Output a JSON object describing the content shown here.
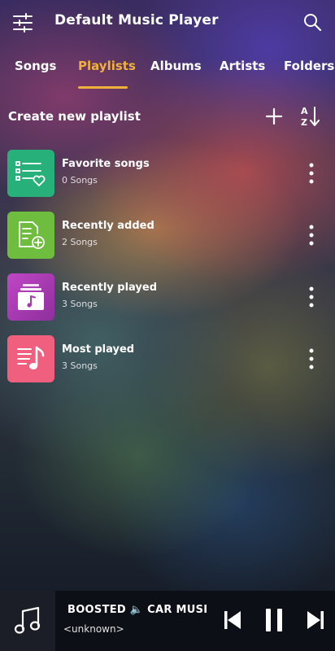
{
  "header": {
    "title": "Default Music Player",
    "menu_icon": "equalizer-sliders-icon",
    "search_icon": "search-icon"
  },
  "tabs": [
    {
      "label": "Songs",
      "active": false
    },
    {
      "label": "Playlists",
      "active": true
    },
    {
      "label": "Albums",
      "active": false
    },
    {
      "label": "Artists",
      "active": false
    },
    {
      "label": "Folders",
      "active": false
    }
  ],
  "create_row": {
    "label": "Create new playlist",
    "add_icon": "plus-icon",
    "sort_icon": "sort-a-z-icon"
  },
  "playlists": [
    {
      "title": "Favorite songs",
      "subtitle": "0 Songs",
      "icon": "favorite-list-icon",
      "color": "#27b07a"
    },
    {
      "title": "Recently added",
      "subtitle": "2 Songs",
      "icon": "add-document-icon",
      "color": "#6ebd3f"
    },
    {
      "title": "Recently played",
      "subtitle": "3 Songs",
      "icon": "music-box-icon",
      "color": "#b13fb8"
    },
    {
      "title": "Most played",
      "subtitle": "3 Songs",
      "icon": "music-list-icon",
      "color": "#f0607e"
    }
  ],
  "player": {
    "track_before": "BOOSTED",
    "track_after": "CAR MUSIC",
    "artist": "<unknown>",
    "accent": "#4da3ff"
  },
  "colors": {
    "active_tab": "#f0b13a"
  }
}
